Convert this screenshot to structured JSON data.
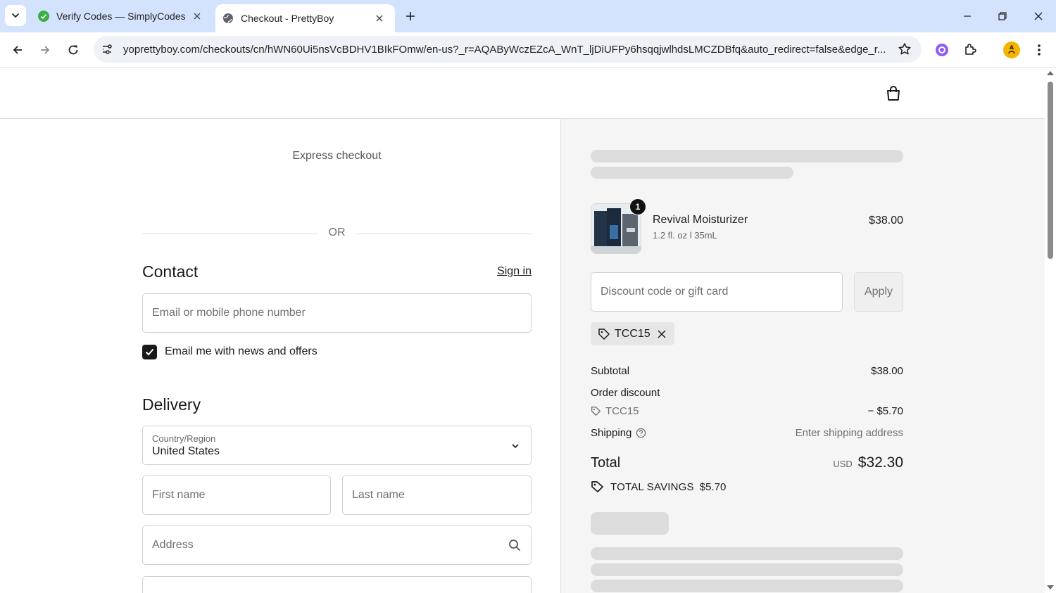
{
  "browser": {
    "tabs": [
      {
        "title": "Verify Codes — SimplyCodes",
        "active": false
      },
      {
        "title": "Checkout - PrettyBoy",
        "active": true
      }
    ],
    "url": "yoprettyboy.com/checkouts/cn/hWN60Ui5nsVcBDHV1BIkFOmw/en-us?_r=AQAByWczEZcA_WnT_ljDiUFPy6hsqqjwlhdsLMCZDBfq&auto_redirect=false&edge_r..."
  },
  "checkout": {
    "express_label": "Express checkout",
    "or_label": "OR",
    "contact": {
      "title": "Contact",
      "signin": "Sign in",
      "email_placeholder": "Email or mobile phone number",
      "newsletter_label": "Email me with news and offers",
      "newsletter_checked": true
    },
    "delivery": {
      "title": "Delivery",
      "country_label": "Country/Region",
      "country_value": "United States",
      "first_name_placeholder": "First name",
      "last_name_placeholder": "Last name",
      "address_placeholder": "Address"
    }
  },
  "summary": {
    "product": {
      "quantity": "1",
      "name": "Revival Moisturizer",
      "variant": "1.2 fl. oz l 35mL",
      "price": "$38.00"
    },
    "discount_placeholder": "Discount code or gift card",
    "apply_label": "Apply",
    "applied_code": "TCC15",
    "subtotal_label": "Subtotal",
    "subtotal_value": "$38.00",
    "order_discount_label": "Order discount",
    "order_discount_code": "TCC15",
    "order_discount_value": "− $5.70",
    "shipping_label": "Shipping",
    "shipping_value": "Enter shipping address",
    "total_label": "Total",
    "total_currency": "USD",
    "total_value": "$32.30",
    "savings_label": "TOTAL SAVINGS",
    "savings_value": "$5.70"
  },
  "colors": {
    "tabstrip": "#d3e3fd",
    "summary_bg": "#f5f5f5",
    "skeleton": "#dcdcdc"
  }
}
